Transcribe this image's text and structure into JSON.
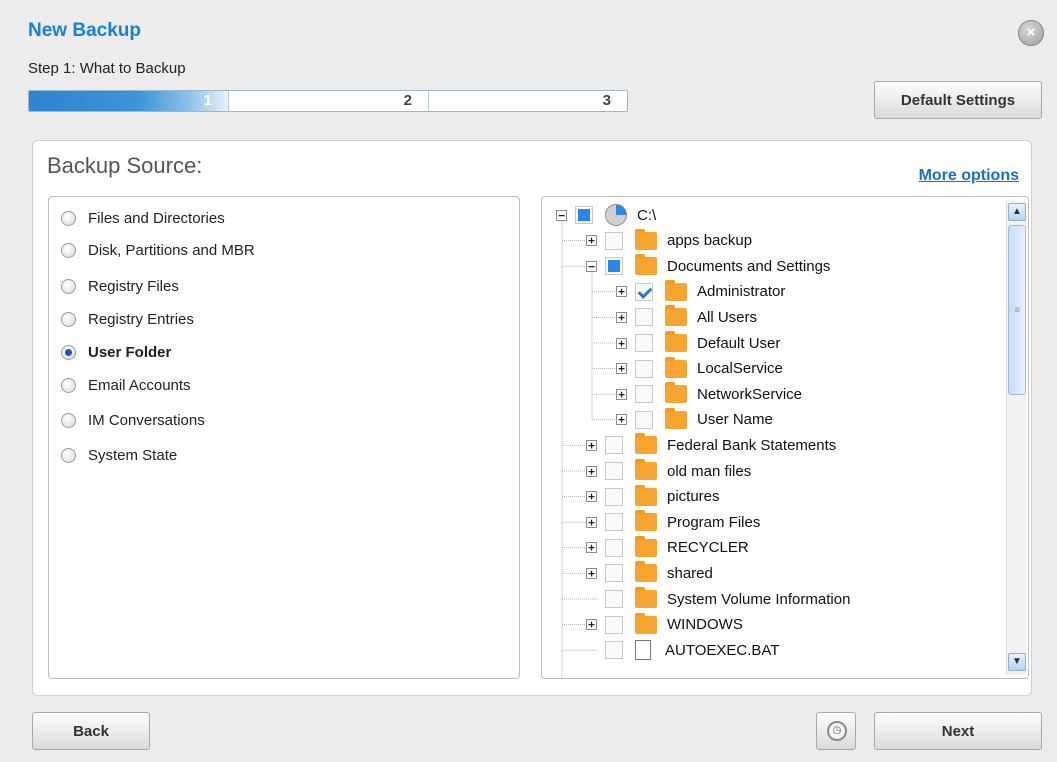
{
  "dialog": {
    "title": "New Backup",
    "close_icon": "×",
    "step_label": "Step 1: What to Backup",
    "steps": [
      "1",
      "2",
      "3"
    ],
    "current_step": 1,
    "progress_fraction": 0.333
  },
  "buttons": {
    "default_settings": "Default Settings",
    "back": "Back",
    "next": "Next",
    "schedule_icon": "alarm-clock-icon"
  },
  "source_panel": {
    "title": "Backup Source:",
    "more_options": "More options",
    "options": [
      {
        "label": "Files and Directories",
        "selected": false
      },
      {
        "label": "Disk, Partitions and MBR",
        "selected": false
      },
      {
        "label": "Registry Files",
        "selected": false
      },
      {
        "label": "Registry Entries",
        "selected": false
      },
      {
        "label": "User Folder",
        "selected": true
      },
      {
        "label": "Email Accounts",
        "selected": false
      },
      {
        "label": "IM Conversations",
        "selected": false
      },
      {
        "label": "System State",
        "selected": false
      }
    ]
  },
  "tree": {
    "nodes": [
      {
        "label": "C:\\",
        "level": 0,
        "expander": "−",
        "check": "partial",
        "icon": "drive-icon"
      },
      {
        "label": "apps backup",
        "level": 1,
        "expander": "+",
        "check": "unchecked",
        "icon": "folder-icon"
      },
      {
        "label": "Documents and Settings",
        "level": 1,
        "expander": "−",
        "check": "partial",
        "icon": "folder-icon"
      },
      {
        "label": "Administrator",
        "level": 2,
        "expander": "+",
        "check": "checked",
        "icon": "folder-icon"
      },
      {
        "label": "All Users",
        "level": 2,
        "expander": "+",
        "check": "unchecked",
        "icon": "folder-icon"
      },
      {
        "label": "Default User",
        "level": 2,
        "expander": "+",
        "check": "unchecked",
        "icon": "folder-icon"
      },
      {
        "label": "LocalService",
        "level": 2,
        "expander": "+",
        "check": "unchecked",
        "icon": "folder-icon"
      },
      {
        "label": "NetworkService",
        "level": 2,
        "expander": "+",
        "check": "unchecked",
        "icon": "folder-icon"
      },
      {
        "label": "User Name",
        "level": 2,
        "expander": "+",
        "check": "unchecked",
        "icon": "folder-icon"
      },
      {
        "label": "Federal Bank Statements",
        "level": 1,
        "expander": "+",
        "check": "unchecked",
        "icon": "folder-icon"
      },
      {
        "label": "old man files",
        "level": 1,
        "expander": "+",
        "check": "unchecked",
        "icon": "folder-icon"
      },
      {
        "label": "pictures",
        "level": 1,
        "expander": "+",
        "check": "unchecked",
        "icon": "folder-icon"
      },
      {
        "label": "Program Files",
        "level": 1,
        "expander": "+",
        "check": "unchecked",
        "icon": "folder-icon"
      },
      {
        "label": "RECYCLER",
        "level": 1,
        "expander": "+",
        "check": "unchecked",
        "icon": "folder-icon"
      },
      {
        "label": "shared",
        "level": 1,
        "expander": "+",
        "check": "unchecked",
        "icon": "folder-icon"
      },
      {
        "label": "System Volume Information",
        "level": 1,
        "expander": "",
        "check": "unchecked",
        "icon": "folder-icon"
      },
      {
        "label": "WINDOWS",
        "level": 1,
        "expander": "+",
        "check": "unchecked",
        "icon": "folder-icon"
      },
      {
        "label": "AUTOEXEC.BAT",
        "level": 1,
        "expander": "",
        "check": "unchecked",
        "icon": "file-icon"
      }
    ],
    "scroll_up_icon": "chevron-up-icon",
    "scroll_down_icon": "chevron-down-icon"
  },
  "colors": {
    "title": "#1a7fd8",
    "link": "#1a6fc8",
    "check_fill": "#2a86e8",
    "folder": "#f7a531"
  }
}
